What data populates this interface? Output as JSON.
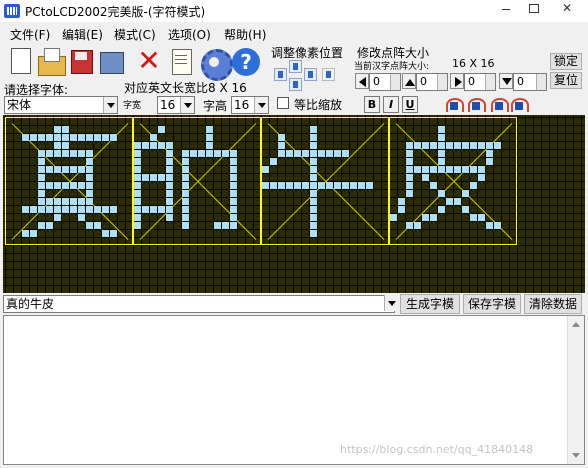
{
  "window": {
    "title": "PCtoLCD2002完美版-(字符模式)"
  },
  "menu": [
    "文件(F)",
    "编辑(E)",
    "模式(C)",
    "选项(O)",
    "帮助(H)"
  ],
  "font": {
    "label": "请选择字体:",
    "selected": "宋体",
    "width_label": "对应英文长宽比8 X 16",
    "char_width_label": "字宽",
    "char_width": "16",
    "char_height_label": "字高",
    "char_height": "16",
    "scale_label": "等比缩放",
    "bold": "B",
    "italic": "I",
    "underline": "U"
  },
  "pixel_shift": {
    "title": "调整像素位置"
  },
  "dot_size": {
    "title": "修改点阵大小",
    "current_label": "当前汉字点阵大小:",
    "current_value": "16 X 16",
    "lock_label": "锁定",
    "reset_label": "复位",
    "values": [
      "0",
      "0",
      "0",
      "0"
    ]
  },
  "text_input": {
    "value": "真的牛皮"
  },
  "buttons": {
    "generate": "生成字模",
    "save": "保存字模",
    "clear": "清除数据"
  },
  "watermark": "https://blog.csdn.net/qq_41840148",
  "colors": {
    "canvas_bg": "#2b2b06",
    "dot_on": "#aee0f5",
    "char_frame": "#ffff00"
  }
}
